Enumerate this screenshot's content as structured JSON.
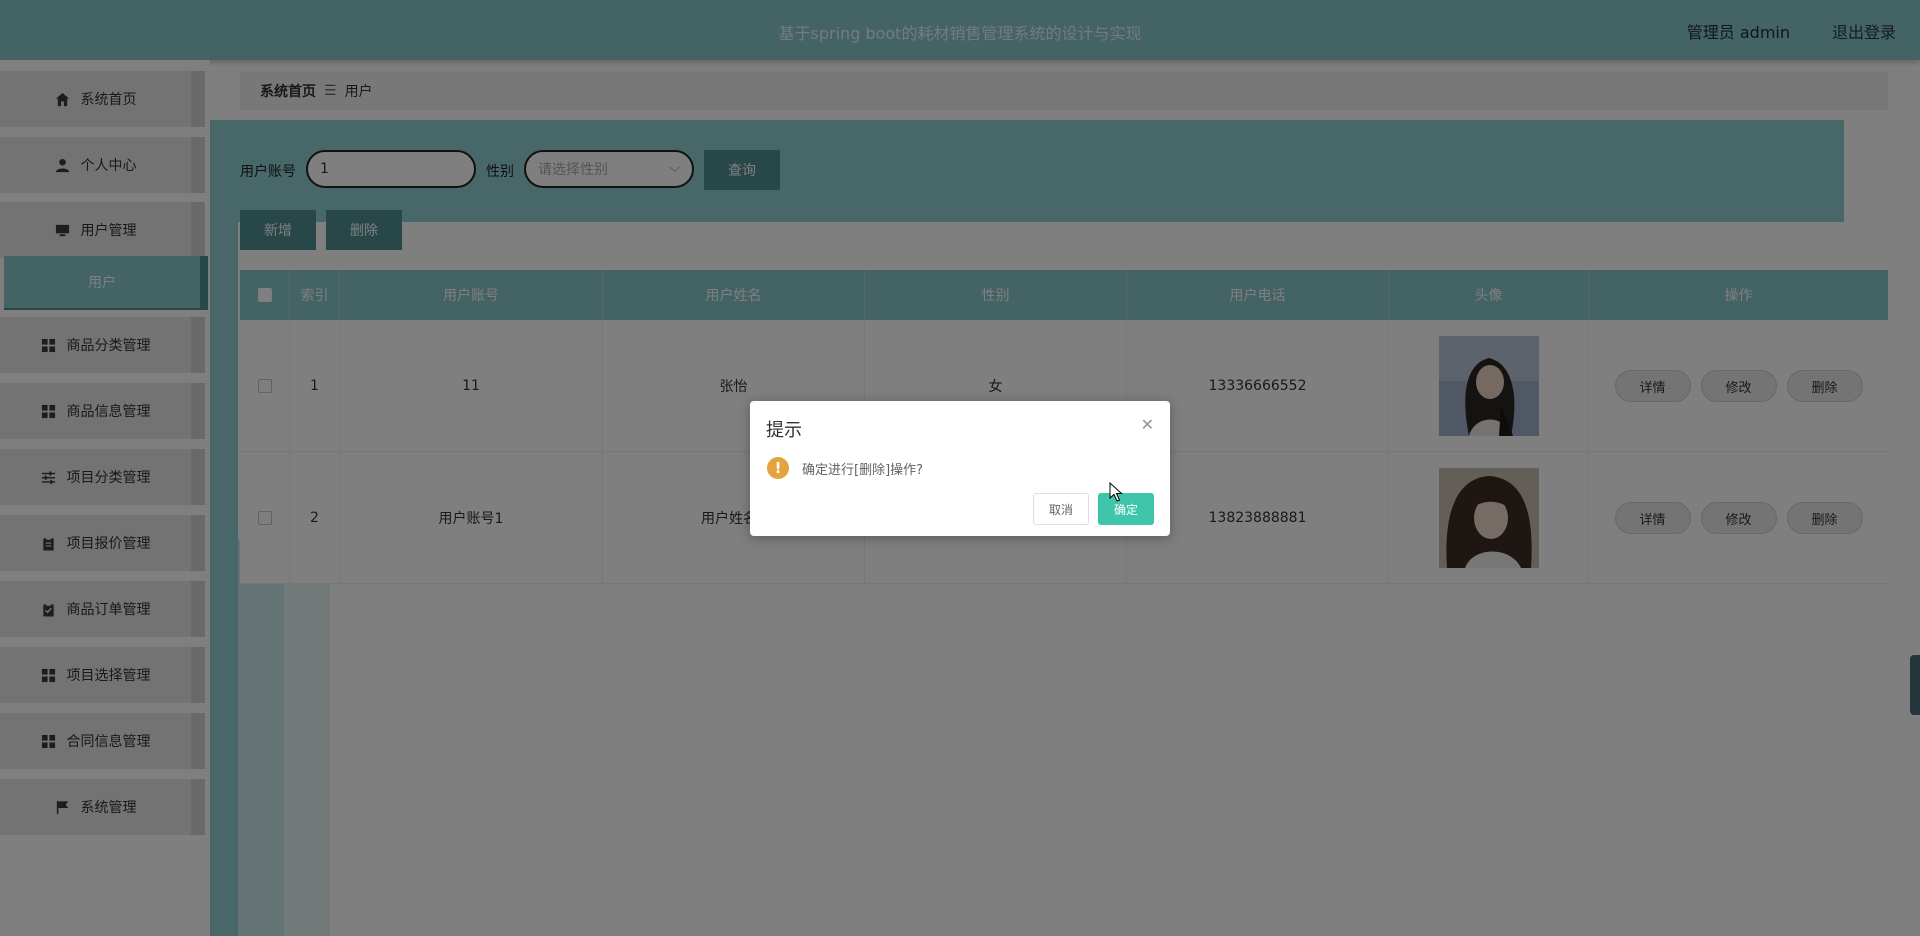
{
  "header": {
    "title": "基于spring boot的耗材销售管理系统的设计与实现",
    "user": "管理员 admin",
    "logout": "退出登录"
  },
  "sidebar": {
    "items": [
      {
        "label": "系统首页",
        "icon": "home-icon"
      },
      {
        "label": "个人中心",
        "icon": "user-icon"
      },
      {
        "label": "用户管理",
        "icon": "monitor-icon"
      },
      {
        "label": "商品分类管理",
        "icon": "grid-icon"
      },
      {
        "label": "商品信息管理",
        "icon": "grid-icon"
      },
      {
        "label": "项目分类管理",
        "icon": "sliders-icon"
      },
      {
        "label": "项目报价管理",
        "icon": "clipboard-icon"
      },
      {
        "label": "商品订单管理",
        "icon": "clipboard-check-icon"
      },
      {
        "label": "项目选择管理",
        "icon": "grid-icon"
      },
      {
        "label": "合同信息管理",
        "icon": "grid-icon"
      },
      {
        "label": "系统管理",
        "icon": "flag-icon"
      }
    ],
    "active_sub": "用户"
  },
  "breadcrumb": {
    "home": "系统首页",
    "sep": "☰",
    "current": "用户"
  },
  "search": {
    "account_label": "用户账号",
    "account_value": "1",
    "gender_label": "性别",
    "gender_placeholder": "请选择性别",
    "query_button": "查询"
  },
  "actions": {
    "add": "新增",
    "delete": "删除"
  },
  "table": {
    "headers": {
      "index": "索引",
      "account": "用户账号",
      "name": "用户姓名",
      "gender": "性别",
      "phone": "用户电话",
      "avatar": "头像",
      "ops": "操作"
    },
    "rows": [
      {
        "index": "1",
        "account": "11",
        "name": "张怡",
        "gender": "女",
        "phone": "13336666552"
      },
      {
        "index": "2",
        "account": "用户账号1",
        "name": "用户姓名1",
        "gender": "",
        "phone": "13823888881"
      }
    ],
    "op_labels": {
      "detail": "详情",
      "edit": "修改",
      "delete": "删除"
    }
  },
  "dialog": {
    "title": "提示",
    "message": "确定进行[删除]操作?",
    "cancel": "取消",
    "confirm": "确定"
  },
  "colors": {
    "accent": "#86c6c9",
    "accent_dark": "#4e8e91",
    "confirm": "#3fc5a9",
    "warning": "#e6a23c"
  }
}
